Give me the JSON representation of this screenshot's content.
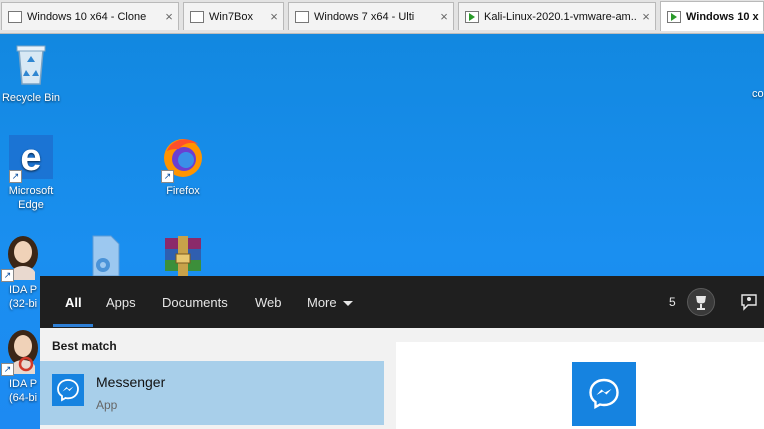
{
  "vm_tabs": [
    {
      "label": "Windows 10 x64 - Clone",
      "close": "×",
      "running": false,
      "active": false
    },
    {
      "label": "Win7Box",
      "close": "×",
      "running": false,
      "active": false
    },
    {
      "label": "Windows 7 x64 - Ulti",
      "close": "×",
      "running": false,
      "active": false
    },
    {
      "label": "Kali-Linux-2020.1-vmware-am...",
      "close": "×",
      "running": true,
      "active": false
    },
    {
      "label": "Windows 10 x",
      "close": "",
      "running": true,
      "active": true
    }
  ],
  "desktop": {
    "icons": {
      "recycle_bin": "Recycle Bin",
      "edge_line1": "Microsoft",
      "edge_line2": "Edge",
      "firefox": "Firefox",
      "ida32_line1": "IDA P",
      "ida32_line2": "(32-bi",
      "ida64_line1": "IDA P",
      "ida64_line2": "(64-bi",
      "right_edge": "co"
    },
    "background_color": "#1a8ff0"
  },
  "search": {
    "tabs": {
      "all": "All",
      "apps": "Apps",
      "documents": "Documents",
      "web": "Web",
      "more": "More"
    },
    "active_tab": "All",
    "reward_points": "5",
    "best_match_heading": "Best match",
    "result": {
      "title": "Messenger",
      "subtitle": "App"
    },
    "accent_color": "#1683e0",
    "selection_color": "#a8cfea"
  }
}
